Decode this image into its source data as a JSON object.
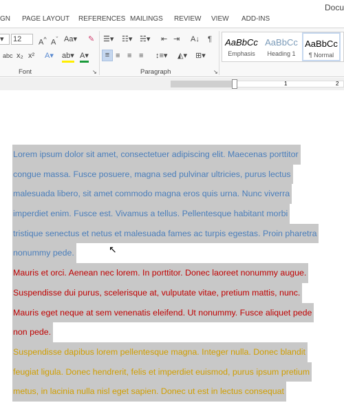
{
  "window": {
    "title": "Docu"
  },
  "tabs": [
    "GN",
    "PAGE LAYOUT",
    "REFERENCES",
    "MAILINGS",
    "REVIEW",
    "VIEW",
    "ADD-INS"
  ],
  "ribbon": {
    "font": {
      "label": "Font",
      "size": "12"
    },
    "paragraph": {
      "label": "Paragraph"
    },
    "styles": [
      {
        "preview": "AaBbCc",
        "label": "Emphasis"
      },
      {
        "preview": "AaBbCc",
        "label": "Heading 1"
      },
      {
        "preview": "AaBbCc",
        "label": "¶ Normal"
      }
    ]
  },
  "ruler": {
    "marks": [
      "1",
      "2"
    ]
  },
  "document": {
    "paragraphs": [
      {
        "color": "blue",
        "lines": [
          "Lorem ipsum dolor sit amet, consectetuer adipiscing elit. Maecenas porttitor",
          "congue massa. Fusce posuere, magna sed pulvinar ultricies, purus lectus",
          "malesuada libero, sit amet commodo magna eros quis urna. Nunc viverra",
          "imperdiet enim. Fusce est. Vivamus a tellus. Pellentesque habitant morbi",
          "tristique senectus et netus et malesuada fames ac turpis egestas. Proin pharetra",
          "nonummy pede."
        ]
      },
      {
        "color": "red",
        "lines": [
          "Mauris et orci. Aenean nec lorem. In porttitor. Donec laoreet nonummy augue.",
          "Suspendisse dui purus, scelerisque at, vulputate vitae, pretium mattis, nunc.",
          "Mauris eget neque at sem venenatis eleifend. Ut nonummy. Fusce aliquet pede",
          "non pede."
        ]
      },
      {
        "color": "gold",
        "lines": [
          "Suspendisse dapibus lorem pellentesque magna. Integer nulla. Donec blandit",
          "feugiat ligula. Donec hendrerit, felis et imperdiet euismod, purus ipsum pretium",
          "metus, in lacinia nulla nisl eget sapien. Donec ut est in lectus consequat"
        ]
      }
    ],
    "highlight_color": "#c8c8c8"
  }
}
